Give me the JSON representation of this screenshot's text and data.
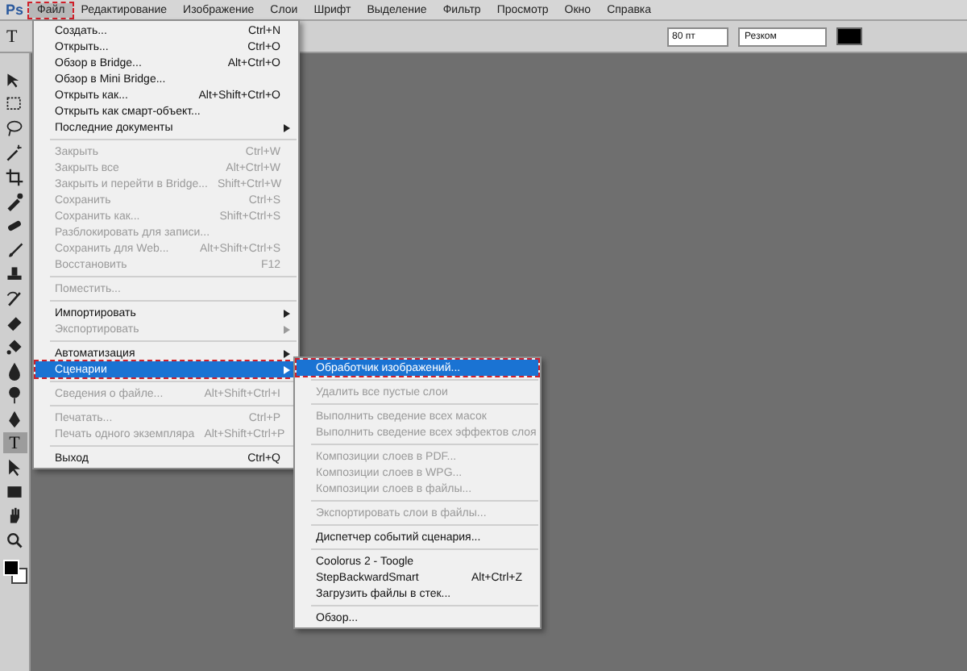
{
  "app_logo": "Ps",
  "menu_bar": [
    {
      "label": "Файл",
      "selected": true,
      "annotated": true
    },
    {
      "label": "Редактирование",
      "selected": false,
      "annotated": false
    },
    {
      "label": "Изображение",
      "selected": false,
      "annotated": false
    },
    {
      "label": "Слои",
      "selected": false,
      "annotated": false
    },
    {
      "label": "Шрифт",
      "selected": false,
      "annotated": false
    },
    {
      "label": "Выделение",
      "selected": false,
      "annotated": false
    },
    {
      "label": "Фильтр",
      "selected": false,
      "annotated": false
    },
    {
      "label": "Просмотр",
      "selected": false,
      "annotated": false
    },
    {
      "label": "Окно",
      "selected": false,
      "annotated": false
    },
    {
      "label": "Справка",
      "selected": false,
      "annotated": false
    }
  ],
  "options_bar": {
    "tool_glyph": "T",
    "size_field": "80 пт",
    "antialias_dropdown": "Резком"
  },
  "toolbar": {
    "tools": [
      {
        "kind": "move",
        "selected": false
      },
      {
        "kind": "marquee",
        "selected": false
      },
      {
        "kind": "lasso",
        "selected": false
      },
      {
        "kind": "wand",
        "selected": false
      },
      {
        "kind": "crop",
        "selected": false
      },
      {
        "kind": "eyedropper",
        "selected": false
      },
      {
        "kind": "heal",
        "selected": false
      },
      {
        "kind": "brush",
        "selected": false
      },
      {
        "kind": "stamp",
        "selected": false
      },
      {
        "kind": "history",
        "selected": false
      },
      {
        "kind": "eraser",
        "selected": false
      },
      {
        "kind": "bucket",
        "selected": false
      },
      {
        "kind": "blur",
        "selected": false
      },
      {
        "kind": "dodge",
        "selected": false
      },
      {
        "kind": "pen",
        "selected": false
      },
      {
        "kind": "type",
        "selected": true,
        "glyph": "T"
      },
      {
        "kind": "select",
        "selected": false
      },
      {
        "kind": "shape",
        "selected": false
      },
      {
        "kind": "hand",
        "selected": false
      },
      {
        "kind": "zoom",
        "selected": false
      }
    ]
  },
  "file_menu": {
    "items": [
      {
        "kind": "item",
        "label": "Создать...",
        "shortcut": "Ctrl+N",
        "disabled": false,
        "submenu": false,
        "selected": false,
        "annotated": false
      },
      {
        "kind": "item",
        "label": "Открыть...",
        "shortcut": "Ctrl+O",
        "disabled": false,
        "submenu": false,
        "selected": false,
        "annotated": false
      },
      {
        "kind": "item",
        "label": "Обзор в Bridge...",
        "shortcut": "Alt+Ctrl+O",
        "disabled": false,
        "submenu": false,
        "selected": false,
        "annotated": false
      },
      {
        "kind": "item",
        "label": "Обзор в Mini Bridge...",
        "disabled": false,
        "submenu": false,
        "selected": false,
        "annotated": false
      },
      {
        "kind": "item",
        "label": "Открыть как...",
        "shortcut": "Alt+Shift+Ctrl+O",
        "disabled": false,
        "submenu": false,
        "selected": false,
        "annotated": false
      },
      {
        "kind": "item",
        "label": "Открыть как смарт-объект...",
        "disabled": false,
        "submenu": false,
        "selected": false,
        "annotated": false
      },
      {
        "kind": "item",
        "label": "Последние документы",
        "disabled": false,
        "submenu": true,
        "selected": false,
        "annotated": false
      },
      {
        "kind": "separator"
      },
      {
        "kind": "item",
        "label": "Закрыть",
        "shortcut": "Ctrl+W",
        "disabled": true,
        "submenu": false,
        "selected": false,
        "annotated": false
      },
      {
        "kind": "item",
        "label": "Закрыть все",
        "shortcut": "Alt+Ctrl+W",
        "disabled": true,
        "submenu": false,
        "selected": false,
        "annotated": false
      },
      {
        "kind": "item",
        "label": "Закрыть и перейти в Bridge...",
        "shortcut": "Shift+Ctrl+W",
        "disabled": true,
        "submenu": false,
        "selected": false,
        "annotated": false
      },
      {
        "kind": "item",
        "label": "Сохранить",
        "shortcut": "Ctrl+S",
        "disabled": true,
        "submenu": false,
        "selected": false,
        "annotated": false
      },
      {
        "kind": "item",
        "label": "Сохранить как...",
        "shortcut": "Shift+Ctrl+S",
        "disabled": true,
        "submenu": false,
        "selected": false,
        "annotated": false
      },
      {
        "kind": "item",
        "label": "Разблокировать для записи...",
        "disabled": true,
        "submenu": false,
        "selected": false,
        "annotated": false
      },
      {
        "kind": "item",
        "label": "Сохранить для Web...",
        "shortcut": "Alt+Shift+Ctrl+S",
        "disabled": true,
        "submenu": false,
        "selected": false,
        "annotated": false
      },
      {
        "kind": "item",
        "label": "Восстановить",
        "shortcut": "F12",
        "disabled": true,
        "submenu": false,
        "selected": false,
        "annotated": false
      },
      {
        "kind": "separator"
      },
      {
        "kind": "item",
        "label": "Поместить...",
        "disabled": true,
        "submenu": false,
        "selected": false,
        "annotated": false
      },
      {
        "kind": "separator"
      },
      {
        "kind": "item",
        "label": "Импортировать",
        "disabled": false,
        "submenu": true,
        "selected": false,
        "annotated": false
      },
      {
        "kind": "item",
        "label": "Экспортировать",
        "disabled": true,
        "submenu": true,
        "selected": false,
        "annotated": false
      },
      {
        "kind": "separator"
      },
      {
        "kind": "item",
        "label": "Автоматизация",
        "disabled": false,
        "submenu": true,
        "selected": false,
        "annotated": false
      },
      {
        "kind": "item",
        "label": "Сценарии",
        "disabled": false,
        "submenu": true,
        "selected": true,
        "annotated": true
      },
      {
        "kind": "separator"
      },
      {
        "kind": "item",
        "label": "Сведения о файле...",
        "shortcut": "Alt+Shift+Ctrl+I",
        "disabled": true,
        "submenu": false,
        "selected": false,
        "annotated": false
      },
      {
        "kind": "separator"
      },
      {
        "kind": "item",
        "label": "Печатать...",
        "shortcut": "Ctrl+P",
        "disabled": true,
        "submenu": false,
        "selected": false,
        "annotated": false
      },
      {
        "kind": "item",
        "label": "Печать одного экземпляра",
        "shortcut": "Alt+Shift+Ctrl+P",
        "disabled": true,
        "submenu": false,
        "selected": false,
        "annotated": false
      },
      {
        "kind": "separator"
      },
      {
        "kind": "item",
        "label": "Выход",
        "shortcut": "Ctrl+Q",
        "disabled": false,
        "submenu": false,
        "selected": false,
        "annotated": false
      }
    ]
  },
  "scripts_submenu": {
    "items": [
      {
        "kind": "item",
        "label": "Обработчик изображений...",
        "disabled": false,
        "submenu": false,
        "selected": true,
        "annotated": true
      },
      {
        "kind": "separator"
      },
      {
        "kind": "item",
        "label": "Удалить все пустые слои",
        "disabled": true,
        "submenu": false,
        "selected": false,
        "annotated": false
      },
      {
        "kind": "separator"
      },
      {
        "kind": "item",
        "label": "Выполнить сведение всех масок",
        "disabled": true,
        "submenu": false,
        "selected": false,
        "annotated": false
      },
      {
        "kind": "item",
        "label": "Выполнить сведение всех эффектов слоя",
        "disabled": true,
        "submenu": false,
        "selected": false,
        "annotated": false
      },
      {
        "kind": "separator"
      },
      {
        "kind": "item",
        "label": "Композиции слоев в PDF...",
        "disabled": true,
        "submenu": false,
        "selected": false,
        "annotated": false
      },
      {
        "kind": "item",
        "label": "Композиции слоев в WPG...",
        "disabled": true,
        "submenu": false,
        "selected": false,
        "annotated": false
      },
      {
        "kind": "item",
        "label": "Композиции слоев в файлы...",
        "disabled": true,
        "submenu": false,
        "selected": false,
        "annotated": false
      },
      {
        "kind": "separator"
      },
      {
        "kind": "item",
        "label": "Экспортировать слои в файлы...",
        "disabled": true,
        "submenu": false,
        "selected": false,
        "annotated": false
      },
      {
        "kind": "separator"
      },
      {
        "kind": "item",
        "label": "Диспетчер событий сценария...",
        "disabled": false,
        "submenu": false,
        "selected": false,
        "annotated": false
      },
      {
        "kind": "separator"
      },
      {
        "kind": "item",
        "label": "Coolorus 2 - Toogle",
        "disabled": false,
        "submenu": false,
        "selected": false,
        "annotated": false
      },
      {
        "kind": "item",
        "label": "StepBackwardSmart",
        "shortcut": "Alt+Ctrl+Z",
        "disabled": false,
        "submenu": false,
        "selected": false,
        "annotated": false
      },
      {
        "kind": "item",
        "label": "Загрузить файлы в стек...",
        "disabled": false,
        "submenu": false,
        "selected": false,
        "annotated": false
      },
      {
        "kind": "separator"
      },
      {
        "kind": "item",
        "label": "Обзор...",
        "disabled": false,
        "submenu": false,
        "selected": false,
        "annotated": false
      }
    ]
  }
}
